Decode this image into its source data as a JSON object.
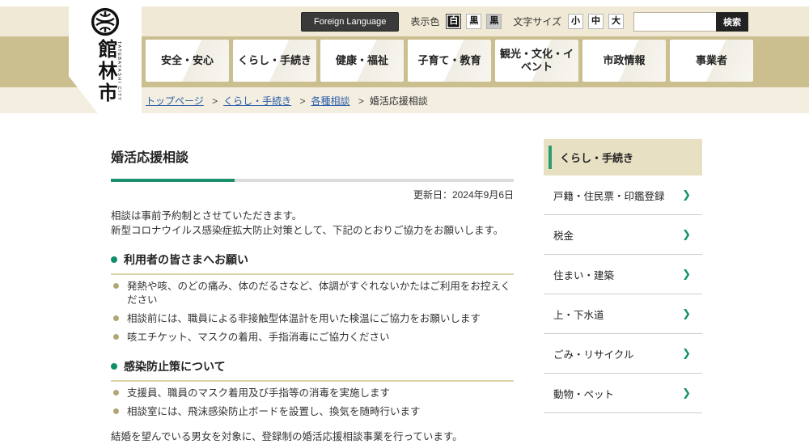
{
  "top_bar": {
    "foreign_language": "Foreign Language",
    "display_color_label": "表示色",
    "color_options": [
      "白",
      "黒",
      "黒"
    ],
    "font_size_label": "文字サイズ",
    "font_size_options": [
      "小",
      "中",
      "大"
    ],
    "search_value": "",
    "search_button": "検索"
  },
  "logo": {
    "city_name": "館林市",
    "city_name_en": "TATEBAYASHI CITY"
  },
  "nav": {
    "tabs": [
      "安全・安心",
      "くらし・手続き",
      "健康・福祉",
      "子育て・教育",
      "観光・文化・イベント",
      "市政情報",
      "事業者"
    ]
  },
  "breadcrumb": {
    "items": [
      "トップページ",
      "くらし・手続き",
      "各種相談"
    ],
    "separator": ">",
    "current": "婚活応援相談"
  },
  "main": {
    "title": "婚活応援相談",
    "updated": "更新日：2024年9月6日",
    "intro": [
      "相談は事前予約制とさせていただきます。",
      "新型コロナウイルス感染症拡大防止対策として、下記のとおりご協力をお願いします。"
    ],
    "sections": [
      {
        "heading": "利用者の皆さまへお願い",
        "bullets": [
          "発熱や咳、のどの痛み、体のだるさなど、体調がすぐれないかたはご利用をお控えください",
          "相談前には、職員による非接触型体温計を用いた検温にご協力をお願いします",
          "咳エチケット、マスクの着用、手指消毒にご協力ください"
        ]
      },
      {
        "heading": "感染防止策について",
        "bullets": [
          "支援員、職員のマスク着用及び手指等の消毒を実施します",
          "相談室には、飛沫感染防止ボードを設置し、換気を随時行います"
        ]
      }
    ],
    "closing": "結婚を望んでいる男女を対象に、登録制の婚活応援相談事業を行っています。"
  },
  "sidebar": {
    "header": "くらし・手続き",
    "items": [
      "戸籍・住民票・印鑑登録",
      "税金",
      "住まい・建築",
      "上・下水道",
      "ごみ・リサイクル",
      "動物・ペット"
    ]
  },
  "icons": {
    "chevron_right": "❯"
  },
  "colors": {
    "accent_green": "#0e8f6a",
    "band_tan": "#cbbe8f",
    "bar_beige": "#f0e9d5",
    "strip_beige": "#f3eee0",
    "sidebar_header_tan": "#e7e0c3",
    "bullet_gold": "#b1a674",
    "link_blue": "#2b5fa8",
    "dark_button": "#3a3a3a"
  }
}
